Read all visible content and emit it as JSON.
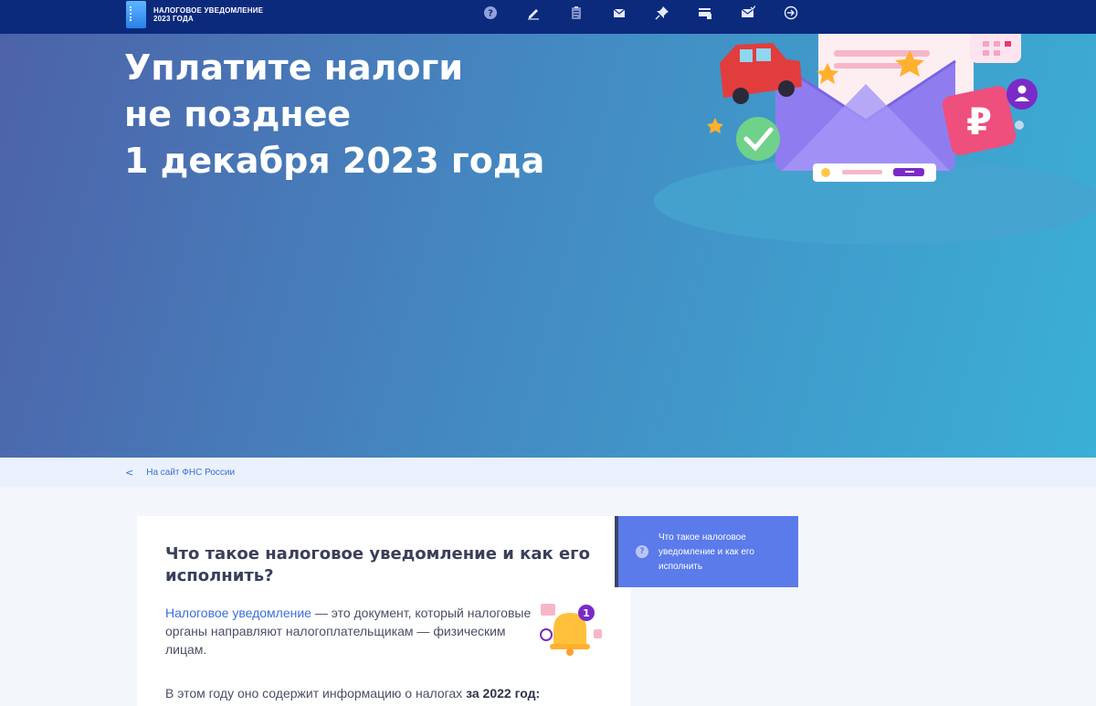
{
  "header": {
    "logo_line1": "НАЛОГОВОЕ УВЕДОМЛЕНИЕ",
    "logo_line2": "2023 ГОДА",
    "nav_icons": [
      "question-icon",
      "pencil-icon",
      "clipboard-icon",
      "envelope-icon",
      "pin-icon",
      "card-icon",
      "mail-check-icon",
      "exit-icon"
    ]
  },
  "hero": {
    "title_line1": "Уплатите налоги",
    "title_line2": "не позднее",
    "title_line3": "1 декабря 2023 года"
  },
  "breadcrumb": {
    "chevron": "<",
    "label": "На сайт ФНС России"
  },
  "article": {
    "title": "Что такое налоговое уведомление и как его исполнить?",
    "link_text": "Налоговое уведомление",
    "body_text": " — это документ, который налоговые органы направляют налогоплательщикам — физическим лицам.",
    "body2_text": "В этом году оно содержит информацию о налогах ",
    "body2_bold": "за 2022 год:",
    "bell_badge": "1"
  },
  "sidenav": {
    "icon": "?",
    "label": "Что такое налоговое уведомление и как его исполнить"
  },
  "colors": {
    "topbar": "#0c2a7c",
    "hero_start": "#4d62a9",
    "hero_end": "#3ab0d6",
    "link": "#3b6fd9",
    "sidenav_active": "#5b7bea"
  }
}
